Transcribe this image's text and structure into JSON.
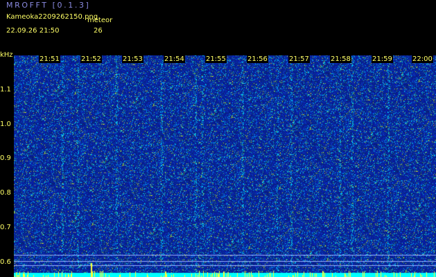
{
  "header": {
    "app_title": "MROFFT [0.1.3]",
    "filename": "Kameoka2209262150.png",
    "datetime": "22.09.26 21:50",
    "meteor_label": "meteor",
    "meteor_count": "26"
  },
  "axis": {
    "y_unit": "kHz",
    "y_ticks": [
      "1.1",
      "1.0",
      "0.9",
      "0.8",
      "0.7",
      "0.6"
    ],
    "x_ticks": [
      "21:51",
      "21:52",
      "21:53",
      "21:54",
      "21:55",
      "21:56",
      "21:57",
      "21:58",
      "21:59",
      "22:00"
    ]
  },
  "colors": {
    "background": "#000000",
    "label": "#ffff66",
    "title": "#8a8ae0",
    "spectrogram_base": "#0a1a8c",
    "baseline": "#00ffff"
  }
}
